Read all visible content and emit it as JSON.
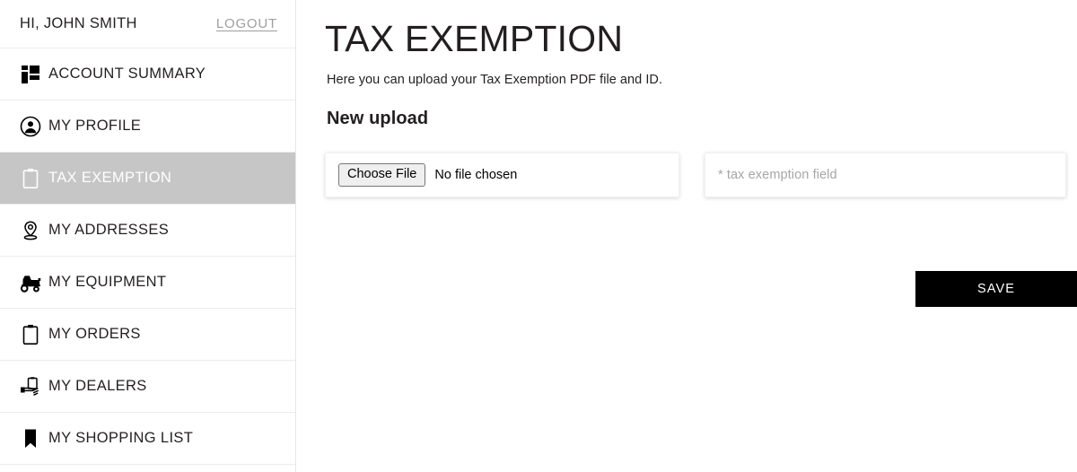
{
  "sidebar": {
    "greeting": "HI, JOHN SMITH",
    "logout_label": "LOGOUT",
    "items": [
      {
        "label": "ACCOUNT SUMMARY",
        "icon": "dashboard-grid-icon",
        "active": false
      },
      {
        "label": "MY PROFILE",
        "icon": "user-circle-icon",
        "active": false
      },
      {
        "label": "TAX EXEMPTION",
        "icon": "clipboard-icon",
        "active": true
      },
      {
        "label": "MY ADDRESSES",
        "icon": "map-pin-icon",
        "active": false
      },
      {
        "label": "MY EQUIPMENT",
        "icon": "tractor-icon",
        "active": false
      },
      {
        "label": "MY ORDERS",
        "icon": "clipboard-icon",
        "active": false
      },
      {
        "label": "MY DEALERS",
        "icon": "handshake-icon",
        "active": false
      },
      {
        "label": "MY SHOPPING LIST",
        "icon": "bookmark-icon",
        "active": false
      }
    ]
  },
  "main": {
    "title": "TAX EXEMPTION",
    "subtitle": "Here you can upload your Tax Exemption PDF file and ID.",
    "section_title": "New upload",
    "file_field": {
      "button_label": "Choose File",
      "status_text": "No file chosen"
    },
    "text_field": {
      "placeholder": "* tax exemption field",
      "value": ""
    },
    "save_label": "SAVE"
  },
  "colors": {
    "active_row": "#c6c6c6",
    "save_button_bg": "#000000",
    "text": "#231f20",
    "muted": "#9e9e9e"
  }
}
